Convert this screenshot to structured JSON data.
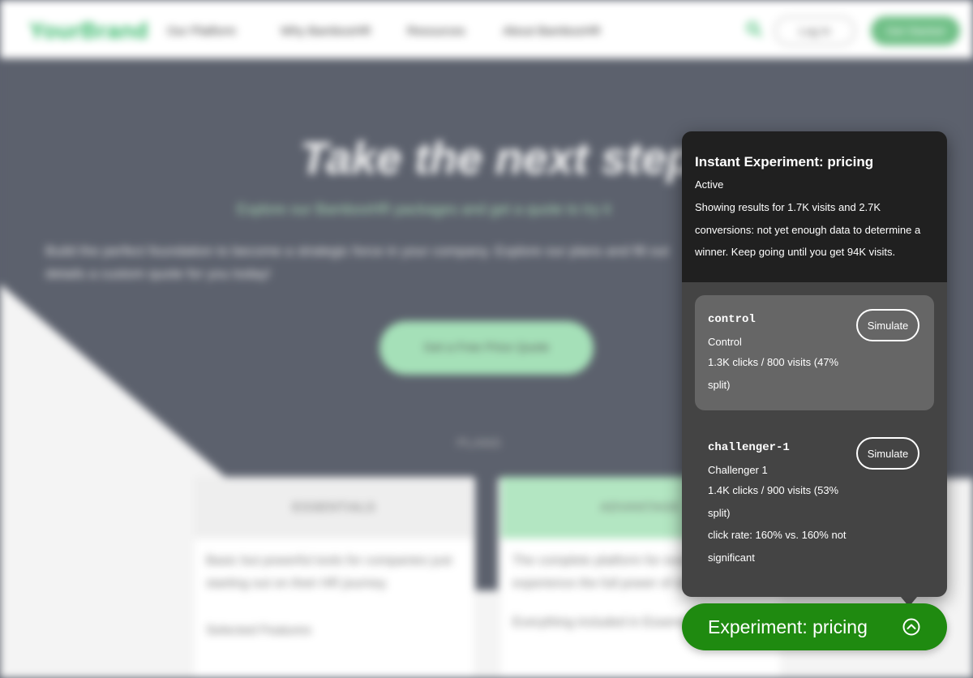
{
  "site": {
    "logo": "YourBrand",
    "nav": {
      "links": [
        "Our Platform",
        "Why BambooHR",
        "Resources",
        "About BambooHR"
      ],
      "login": "Log In",
      "cta": "Get Started"
    },
    "hero": {
      "title": "Take the next step",
      "subtitle": "Explore our BambooHR packages and get a quote to try it",
      "body": "Build the perfect foundation to become a strategic force in your company. Explore our plans and fill out details a custom quote for you today!",
      "cta": "Get a Free Price Quote",
      "plans_label": "PLANS"
    },
    "plans": [
      {
        "name": "ESSENTIALS",
        "desc": "Basic but powerful tools for companies just starting out on their HR journey.",
        "feature": "Selected Features"
      },
      {
        "name": "ADVANTAGE",
        "desc": "The complete platform for every team to experience the full power of strategic HR.",
        "feature": "Everything included in Essentials plus"
      }
    ]
  },
  "experiment": {
    "title": "Instant Experiment: pricing",
    "status": "Active",
    "summary": "Showing results for 1.7K visits and 2.7K conversions: not yet enough data to determine a winner. Keep going until you get 94K visits.",
    "variants": [
      {
        "key": "control",
        "name": "Control",
        "stats": "1.3K clicks / 800 visits (47% split)",
        "simulate_label": "Simulate",
        "selected": true
      },
      {
        "key": "challenger-1",
        "name": "Challenger 1",
        "stats": "1.4K clicks / 900 visits (53% split)",
        "note": "click rate: 160% vs. 160% not significant",
        "simulate_label": "Simulate",
        "selected": false
      }
    ],
    "toggle_label": "Experiment: pricing",
    "toggle_icon": "chevron-up-circle-icon"
  },
  "colors": {
    "panel_bg": "#444444",
    "panel_header_bg": "#202020",
    "selected_variant_bg": "#666666",
    "toggle_bg": "#1f8a10",
    "brand_green": "#37b86a"
  }
}
